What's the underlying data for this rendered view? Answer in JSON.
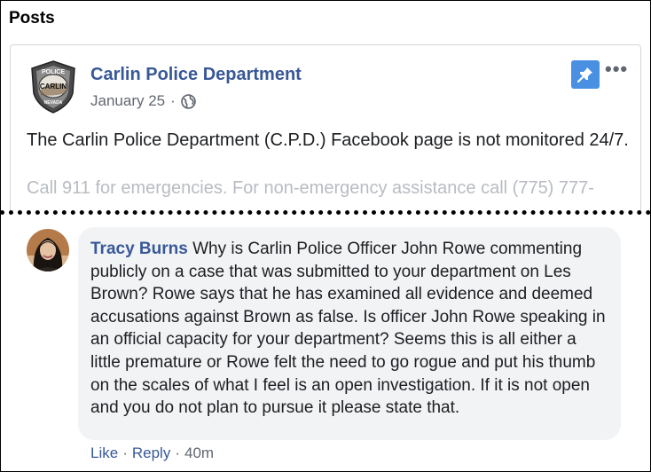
{
  "section": {
    "title": "Posts"
  },
  "post": {
    "page_name": "Carlin Police Department",
    "logo_text_top": "POLICE",
    "logo_text_mid": "CARLIN",
    "logo_text_bottom": "NEVADA",
    "date": "January 25",
    "separator": "·",
    "more_label": "•••",
    "text": "The Carlin Police Department (C.P.D.) Facebook page is not monitored 24/7.",
    "text_faded": "Call 911 for emergencies. For non-emergency assistance call (775) 777-"
  },
  "comment": {
    "author": "Tracy Burns",
    "body": "Why is Carlin Police Officer John Rowe commenting publicly on a case that was submitted to your department on Les Brown? Rowe says that he has examined all evidence and deemed accusations against Brown as false. Is officer John Rowe speaking in an official capacity for your department? Seems this is all either a little premature or Rowe felt the need to go rogue and put his thumb on the scales of what I feel is an open investigation. If it is not open and you do not plan to pursue it please state that.",
    "like_label": "Like",
    "reply_label": "Reply",
    "separator": "·",
    "time": "40m"
  },
  "colors": {
    "link": "#385898",
    "pin": "#4a90e2",
    "bubble": "#f2f3f5"
  }
}
